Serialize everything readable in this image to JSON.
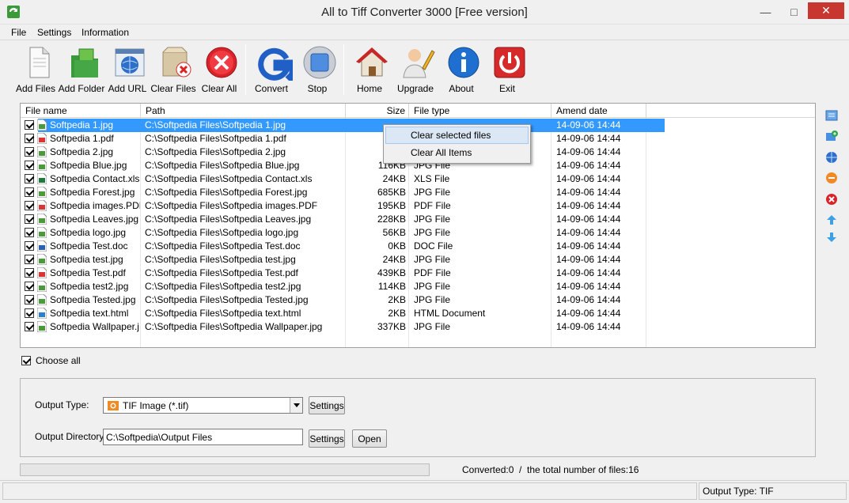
{
  "window": {
    "title": "All to Tiff Converter 3000 [Free version]"
  },
  "menu": [
    "File",
    "Settings",
    "Information"
  ],
  "toolbar": [
    {
      "label": "Add Files",
      "icon": "add-files-icon"
    },
    {
      "label": "Add Folder",
      "icon": "add-folder-icon"
    },
    {
      "label": "Add URL",
      "icon": "add-url-icon"
    },
    {
      "label": "Clear Files",
      "icon": "clear-files-icon"
    },
    {
      "label": "Clear All",
      "icon": "clear-all-icon"
    },
    {
      "label": "Convert",
      "icon": "convert-icon"
    },
    {
      "label": "Stop",
      "icon": "stop-icon"
    },
    {
      "label": "Home",
      "icon": "home-icon"
    },
    {
      "label": "Upgrade",
      "icon": "upgrade-icon"
    },
    {
      "label": "About",
      "icon": "about-icon"
    },
    {
      "label": "Exit",
      "icon": "exit-icon"
    }
  ],
  "columns": [
    "File name",
    "Path",
    "Size",
    "File type",
    "Amend date"
  ],
  "files": [
    {
      "name": "Softpedia 1.jpg",
      "path": "C:\\Softpedia Files\\Softpedia 1.jpg",
      "size": "",
      "type": "",
      "date": "14-09-06 14:44",
      "kind": "jpg"
    },
    {
      "name": "Softpedia 1.pdf",
      "path": "C:\\Softpedia Files\\Softpedia 1.pdf",
      "size": "",
      "type": "",
      "date": "14-09-06 14:44",
      "kind": "pdf"
    },
    {
      "name": "Softpedia 2.jpg",
      "path": "C:\\Softpedia Files\\Softpedia 2.jpg",
      "size": "",
      "type": "",
      "date": "14-09-06 14:44",
      "kind": "jpg"
    },
    {
      "name": "Softpedia Blue.jpg",
      "path": "C:\\Softpedia Files\\Softpedia Blue.jpg",
      "size": "116KB",
      "type": "JPG File",
      "date": "14-09-06 14:44",
      "kind": "jpg"
    },
    {
      "name": "Softpedia Contact.xls",
      "path": "C:\\Softpedia Files\\Softpedia Contact.xls",
      "size": "24KB",
      "type": "XLS File",
      "date": "14-09-06 14:44",
      "kind": "xls"
    },
    {
      "name": "Softpedia Forest.jpg",
      "path": "C:\\Softpedia Files\\Softpedia Forest.jpg",
      "size": "685KB",
      "type": "JPG File",
      "date": "14-09-06 14:44",
      "kind": "jpg"
    },
    {
      "name": "Softpedia images.PDF",
      "path": "C:\\Softpedia Files\\Softpedia images.PDF",
      "size": "195KB",
      "type": "PDF File",
      "date": "14-09-06 14:44",
      "kind": "pdf"
    },
    {
      "name": "Softpedia Leaves.jpg",
      "path": "C:\\Softpedia Files\\Softpedia Leaves.jpg",
      "size": "228KB",
      "type": "JPG File",
      "date": "14-09-06 14:44",
      "kind": "jpg"
    },
    {
      "name": "Softpedia logo.jpg",
      "path": "C:\\Softpedia Files\\Softpedia logo.jpg",
      "size": "56KB",
      "type": "JPG File",
      "date": "14-09-06 14:44",
      "kind": "jpg"
    },
    {
      "name": "Softpedia Test.doc",
      "path": "C:\\Softpedia Files\\Softpedia Test.doc",
      "size": "0KB",
      "type": "DOC File",
      "date": "14-09-06 14:44",
      "kind": "doc"
    },
    {
      "name": "Softpedia test.jpg",
      "path": "C:\\Softpedia Files\\Softpedia test.jpg",
      "size": "24KB",
      "type": "JPG File",
      "date": "14-09-06 14:44",
      "kind": "jpg"
    },
    {
      "name": "Softpedia Test.pdf",
      "path": "C:\\Softpedia Files\\Softpedia Test.pdf",
      "size": "439KB",
      "type": "PDF File",
      "date": "14-09-06 14:44",
      "kind": "pdf"
    },
    {
      "name": "Softpedia test2.jpg",
      "path": "C:\\Softpedia Files\\Softpedia test2.jpg",
      "size": "114KB",
      "type": "JPG File",
      "date": "14-09-06 14:44",
      "kind": "jpg"
    },
    {
      "name": "Softpedia Tested.jpg",
      "path": "C:\\Softpedia Files\\Softpedia Tested.jpg",
      "size": "2KB",
      "type": "JPG File",
      "date": "14-09-06 14:44",
      "kind": "jpg"
    },
    {
      "name": "Softpedia text.html",
      "path": "C:\\Softpedia Files\\Softpedia text.html",
      "size": "2KB",
      "type": "HTML Document",
      "date": "14-09-06 14:44",
      "kind": "html"
    },
    {
      "name": "Softpedia Wallpaper.j...",
      "path": "C:\\Softpedia Files\\Softpedia Wallpaper.jpg",
      "size": "337KB",
      "type": "JPG File",
      "date": "14-09-06 14:44",
      "kind": "jpg"
    }
  ],
  "context_menu": [
    "Clear selected files",
    "Clear All Items"
  ],
  "choose_all": "Choose all",
  "output": {
    "type_label": "Output Type:",
    "type_value": "TIF Image (*.tif)",
    "dir_label": "Output Directory:",
    "dir_value": "C:\\Softpedia\\Output Files",
    "settings": "Settings",
    "open": "Open"
  },
  "progress_text": "Converted:0  /  the total number of files:16",
  "status_output": "Output Type: TIF"
}
